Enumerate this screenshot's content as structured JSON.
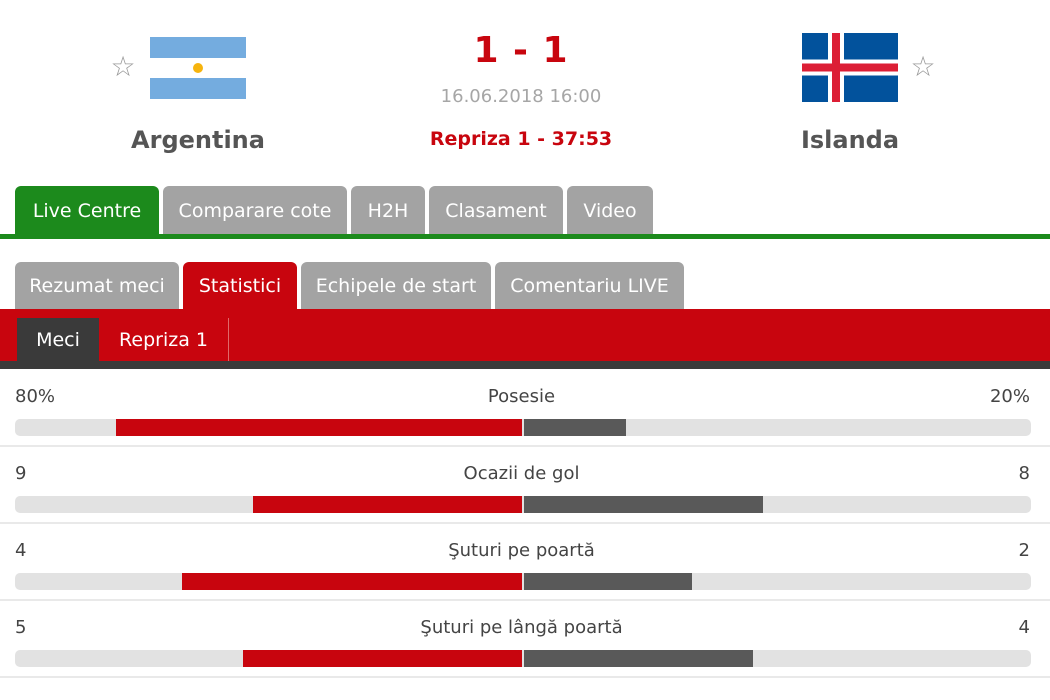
{
  "match": {
    "home_team": "Argentina",
    "away_team": "Islanda",
    "score": "1 - 1",
    "datetime": "16.06.2018 16:00",
    "status": "Repriza 1 - 37:53"
  },
  "icons": {
    "star": "☆"
  },
  "colors": {
    "accent_red": "#c8050e",
    "tab_green": "#1c8a1c",
    "tab_gray": "#a3a3a3",
    "away_bar": "#595959"
  },
  "main_tabs": [
    {
      "label": "Live Centre",
      "active": true
    },
    {
      "label": "Comparare cote",
      "active": false
    },
    {
      "label": "H2H",
      "active": false
    },
    {
      "label": "Clasament",
      "active": false
    },
    {
      "label": "Video",
      "active": false
    }
  ],
  "sub_tabs": [
    {
      "label": "Rezumat meci",
      "active": false
    },
    {
      "label": "Statistici",
      "active": true
    },
    {
      "label": "Echipele de start",
      "active": false
    },
    {
      "label": "Comentariu LIVE",
      "active": false
    }
  ],
  "period_tabs": [
    {
      "label": "Meci",
      "active": true
    },
    {
      "label": "Repriza 1",
      "active": false
    }
  ],
  "stats": [
    {
      "label": "Posesie",
      "home": "80%",
      "away": "20%",
      "home_share": 0.8,
      "away_share": 0.2
    },
    {
      "label": "Ocazii de gol",
      "home": "9",
      "away": "8",
      "home_share": 0.53,
      "away_share": 0.47
    },
    {
      "label": "Şuturi pe poartă",
      "home": "4",
      "away": "2",
      "home_share": 0.67,
      "away_share": 0.33
    },
    {
      "label": "Şuturi pe lângă poartă",
      "home": "5",
      "away": "4",
      "home_share": 0.55,
      "away_share": 0.45
    }
  ]
}
